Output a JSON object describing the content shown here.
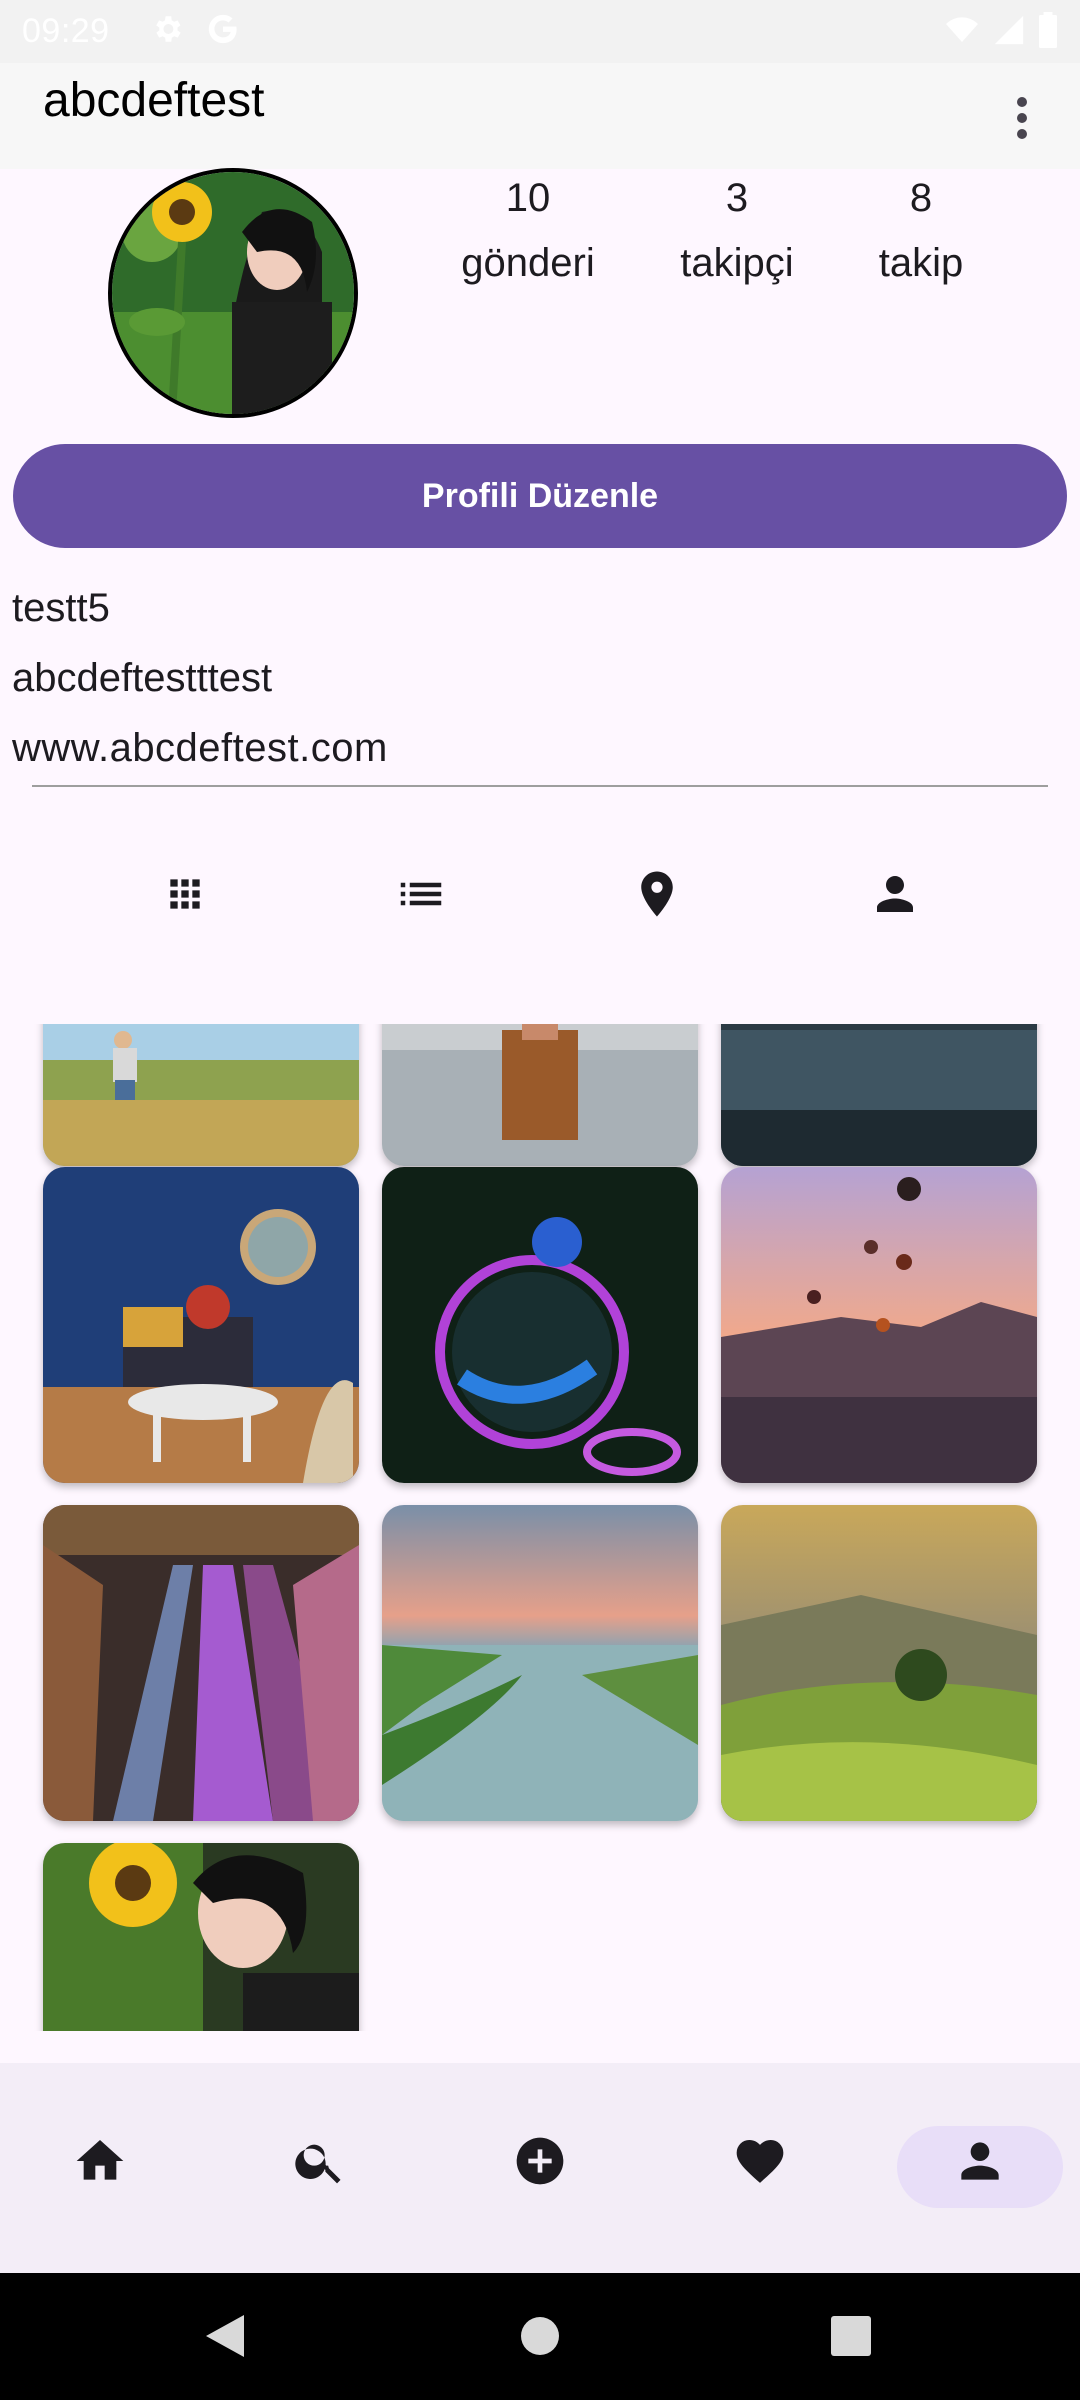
{
  "status_bar": {
    "time": "09:29",
    "icons": [
      "settings-icon",
      "google-icon",
      "wifi-icon",
      "signal-icon",
      "battery-icon"
    ]
  },
  "app_bar": {
    "title": "abcdeftest",
    "more_icon": "more-vert-icon"
  },
  "profile": {
    "stats": [
      {
        "value": "10",
        "label": "gönderi"
      },
      {
        "value": "3",
        "label": "takipçi"
      },
      {
        "value": "8",
        "label": "takip"
      }
    ],
    "edit_button_label": "Profili Düzenle",
    "bio": {
      "name": "testt5",
      "description": "abcdeftestttest",
      "website": "www.abcdeftest.com"
    }
  },
  "tabs": [
    {
      "icon": "grid-icon"
    },
    {
      "icon": "list-icon"
    },
    {
      "icon": "location-icon"
    },
    {
      "icon": "person-tag-icon"
    }
  ],
  "posts": [
    "field-child-photo",
    "woman-lake-photo",
    "dark-water-photo",
    "living-room-photo",
    "soap-bubble-photo",
    "hot-air-balloons-photo",
    "escalator-photo",
    "river-sunset-photo",
    "rice-terrace-photo",
    "woman-sunflower-photo"
  ],
  "bottom_nav": [
    {
      "icon": "home-icon"
    },
    {
      "icon": "search-icon"
    },
    {
      "icon": "add-circle-icon"
    },
    {
      "icon": "heart-icon"
    },
    {
      "icon": "profile-icon",
      "active": true
    }
  ],
  "colors": {
    "primary": "#6750a4",
    "background": "#fef7ff",
    "nav_background": "#f3edf7",
    "active_pill": "#e8def8"
  }
}
